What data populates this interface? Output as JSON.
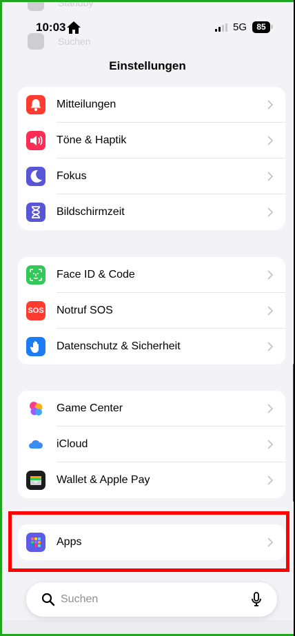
{
  "status_bar": {
    "time": "10:03",
    "network": "5G",
    "battery": "85"
  },
  "background_rows": [
    {
      "label": "Standby"
    },
    {
      "label": "Suchen"
    }
  ],
  "header": {
    "title": "Einstellungen"
  },
  "groups": [
    {
      "items": [
        {
          "key": "mitteilungen",
          "label": "Mitteilungen",
          "icon": "bell-icon",
          "color": "#ff3b30"
        },
        {
          "key": "toene",
          "label": "Töne & Haptik",
          "icon": "speaker-icon",
          "color": "#ff2d55"
        },
        {
          "key": "fokus",
          "label": "Fokus",
          "icon": "moon-icon",
          "color": "#5856d6"
        },
        {
          "key": "bildschirmzeit",
          "label": "Bildschirmzeit",
          "icon": "hourglass-icon",
          "color": "#5856d6"
        }
      ]
    },
    {
      "items": [
        {
          "key": "faceid",
          "label": "Face ID & Code",
          "icon": "face-id-icon",
          "color": "#34c759"
        },
        {
          "key": "notruf",
          "label": "Notruf SOS",
          "icon": "sos-icon",
          "icon_text": "SOS",
          "color": "#ff3b30"
        },
        {
          "key": "datenschutz",
          "label": "Datenschutz & Sicherheit",
          "icon": "hand-icon",
          "color": "#1e7cf2"
        }
      ]
    },
    {
      "items": [
        {
          "key": "gamecenter",
          "label": "Game Center",
          "icon": "game-center-icon",
          "color": "#ffffff"
        },
        {
          "key": "icloud",
          "label": "iCloud",
          "icon": "cloud-icon",
          "color": "#ffffff"
        },
        {
          "key": "wallet",
          "label": "Wallet & Apple Pay",
          "icon": "wallet-icon",
          "color": "#1c1c1e"
        }
      ]
    },
    {
      "items": [
        {
          "key": "apps",
          "label": "Apps",
          "icon": "apps-grid-icon",
          "color": "#5e5ce6"
        }
      ]
    }
  ],
  "search": {
    "placeholder": "Suchen"
  },
  "colors": {
    "highlight": "#ff0000",
    "frame": "#1fa81f"
  }
}
